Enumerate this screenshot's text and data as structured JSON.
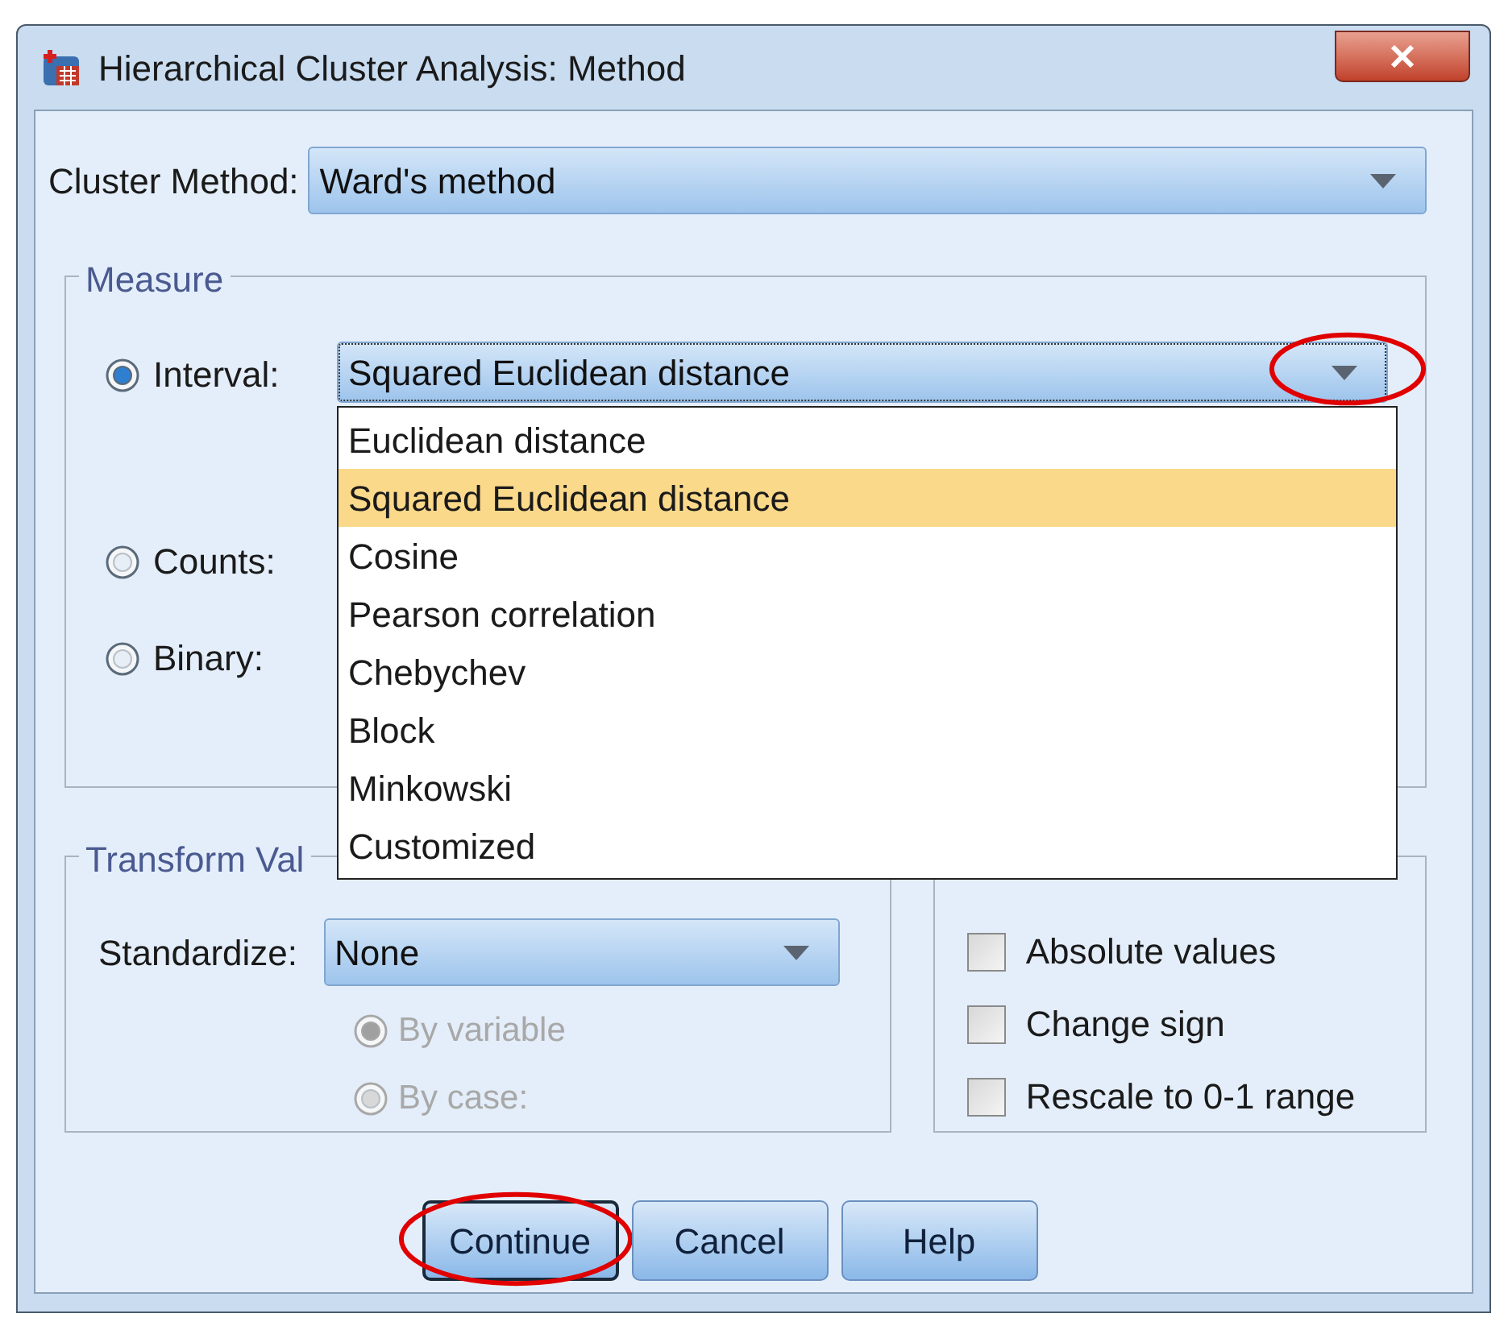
{
  "window": {
    "title": "Hierarchical Cluster Analysis: Method"
  },
  "cluster_method": {
    "label": "Cluster Method:",
    "value": "Ward's method"
  },
  "measure": {
    "legend": "Measure",
    "options": [
      {
        "label": "Interval:",
        "selected": true
      },
      {
        "label": "Counts:",
        "selected": false
      },
      {
        "label": "Binary:",
        "selected": false
      }
    ],
    "interval_combo": {
      "value": "Squared Euclidean distance",
      "circled": true
    },
    "interval_list": [
      {
        "label": "Euclidean distance",
        "selected": false
      },
      {
        "label": "Squared Euclidean distance",
        "selected": true
      },
      {
        "label": "Cosine",
        "selected": false
      },
      {
        "label": "Pearson correlation",
        "selected": false
      },
      {
        "label": "Chebychev",
        "selected": false
      },
      {
        "label": "Block",
        "selected": false
      },
      {
        "label": "Minkowski",
        "selected": false
      },
      {
        "label": "Customized",
        "selected": false
      }
    ]
  },
  "transform_values": {
    "legend": "Transform Val",
    "standardize": {
      "label": "Standardize:",
      "value": "None"
    },
    "options": [
      {
        "label": "By variable",
        "selected": true,
        "disabled": true
      },
      {
        "label": "By case:",
        "selected": false,
        "disabled": true
      }
    ]
  },
  "transform_measures": {
    "options": [
      {
        "label": "Absolute values",
        "checked": false
      },
      {
        "label": "Change sign",
        "checked": false
      },
      {
        "label": "Rescale to 0-1 range",
        "checked": false
      }
    ]
  },
  "buttons": [
    {
      "label": "Continue",
      "default": true,
      "circled": true
    },
    {
      "label": "Cancel",
      "default": false,
      "circled": false
    },
    {
      "label": "Help",
      "default": false,
      "circled": false
    }
  ]
}
